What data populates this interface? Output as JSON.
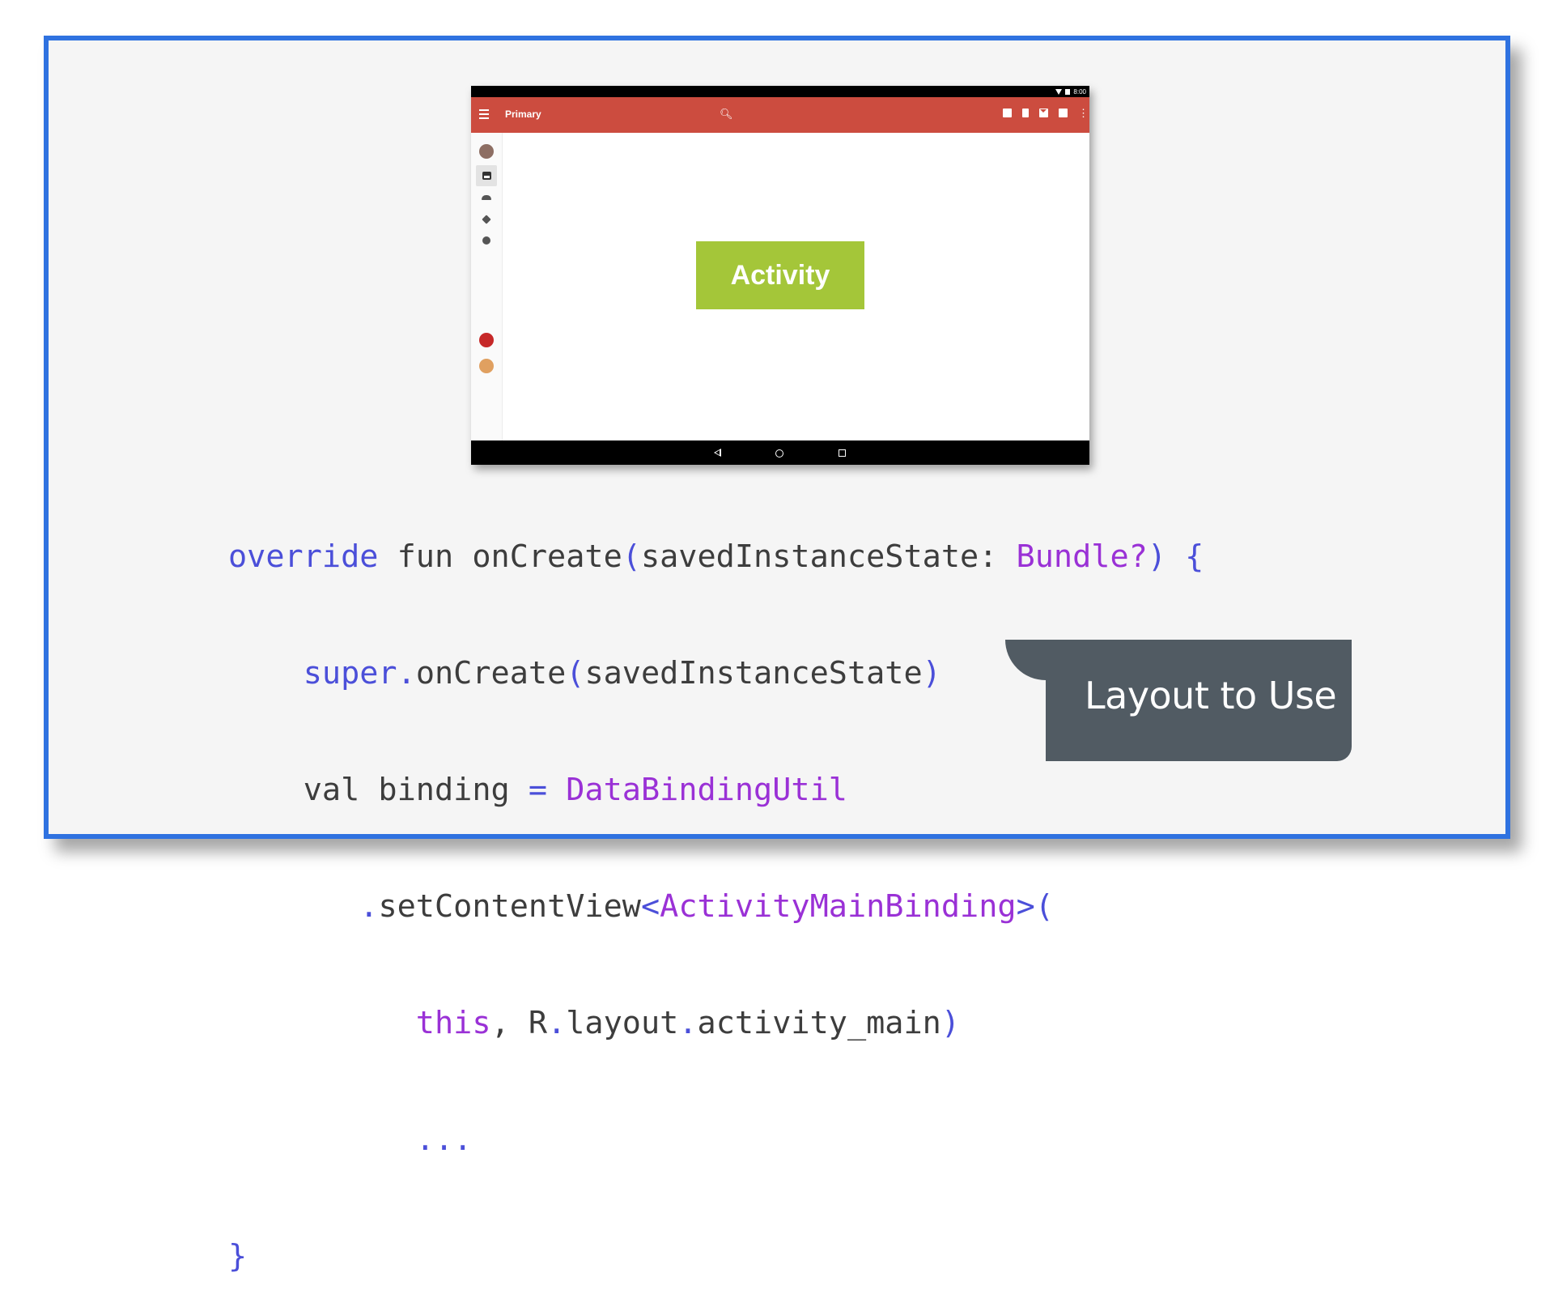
{
  "device": {
    "status_time": "8:00",
    "appbar_title": "Primary",
    "center_label": "Activity",
    "icons": {
      "menu": "menu-icon",
      "search": "search-icon",
      "actions": [
        "archive-icon",
        "delete-icon",
        "mail-icon",
        "move-to-folder-icon",
        "more-vert-icon"
      ],
      "rail": [
        "avatar-icon",
        "inbox-icon",
        "people-icon",
        "tag-icon",
        "info-icon",
        "avatar-icon",
        "avatar-icon"
      ],
      "nav": [
        "back-icon",
        "home-icon",
        "recents-icon"
      ]
    },
    "colors": {
      "appbar": "#cc4c3f",
      "activity_box": "#a4c639"
    }
  },
  "code": {
    "l1": {
      "override": "override",
      "fun": " fun onCreate",
      "p1": "(",
      "param": "savedInstanceState",
      "colon": ": ",
      "type": "Bundle?",
      "p2": ") {"
    },
    "l2": {
      "indent": "    ",
      "super": "super",
      "dot": ".",
      "call": "onCreate",
      "p1": "(",
      "arg": "savedInstanceState",
      "p2": ")"
    },
    "l3": {
      "indent": "    ",
      "val": "val binding ",
      "eq": "=",
      "sp": " ",
      "type": "DataBindingUtil"
    },
    "l4": {
      "indent": "       ",
      "dot": ".",
      "method": "setContentView",
      "lt": "<",
      "type": "ActivityMainBinding",
      "gt": ">",
      "p1": "("
    },
    "l5": {
      "indent": "          ",
      "this": "this",
      "comma": ", R",
      "dot1": ".",
      "layout": "layout",
      "dot2": ".",
      "name": "activity_main",
      "p2": ")"
    },
    "l6": {
      "indent": "          ",
      "dots": "..."
    },
    "l7": {
      "brace": "}"
    }
  },
  "callout": {
    "text": "Layout to Use"
  }
}
